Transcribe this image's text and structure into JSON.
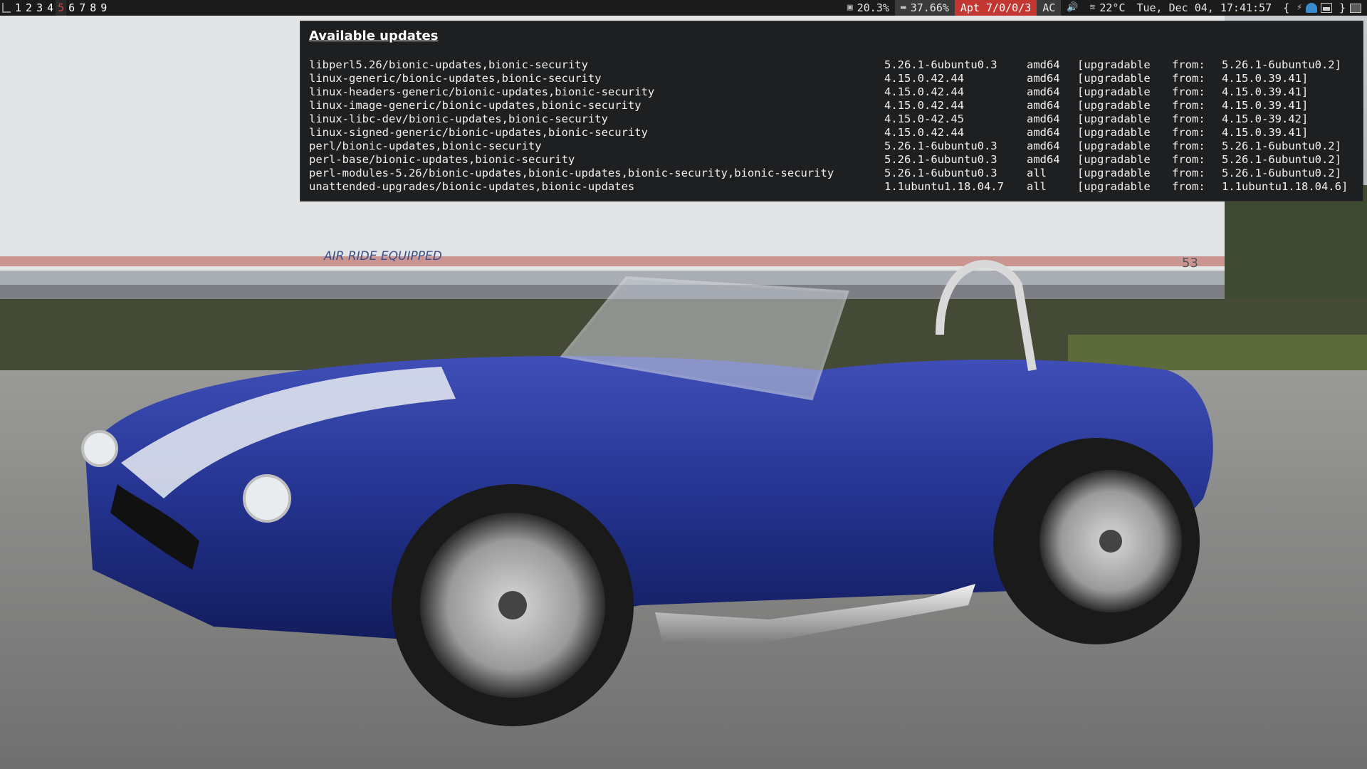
{
  "topbar": {
    "workspaces": [
      "1",
      "2",
      "3",
      "4",
      "5",
      "6",
      "7",
      "8",
      "9"
    ],
    "active_workspace_index": 4,
    "cpu": "20.3%",
    "memory": "37.66%",
    "apt": "Apt 7/0/0/3",
    "power": "AC",
    "temperature": "22°C",
    "datetime": "Tue, Dec 04, 17:41:57",
    "brace_open": "{",
    "brace_close": "}",
    "icons": [
      "layout-icon",
      "cpu-icon",
      "memory-icon",
      "volume-icon",
      "temperature-icon",
      "battery-tray-icon",
      "network-tray-icon",
      "display-tray-icon"
    ],
    "colors": {
      "apt_bg": "#c43632",
      "active_ws": "#d64040"
    }
  },
  "updates": {
    "title": "Available updates",
    "rows": [
      [
        "libperl5.26/bionic-updates,bionic-security",
        "5.26.1-6ubuntu0.3",
        "amd64",
        "[upgradable",
        "from:",
        "5.26.1-6ubuntu0.2]"
      ],
      [
        "linux-generic/bionic-updates,bionic-security",
        "4.15.0.42.44",
        "amd64",
        "[upgradable",
        "from:",
        "4.15.0.39.41]"
      ],
      [
        "linux-headers-generic/bionic-updates,bionic-security",
        "4.15.0.42.44",
        "amd64",
        "[upgradable",
        "from:",
        "4.15.0.39.41]"
      ],
      [
        "linux-image-generic/bionic-updates,bionic-security",
        "4.15.0.42.44",
        "amd64",
        "[upgradable",
        "from:",
        "4.15.0.39.41]"
      ],
      [
        "linux-libc-dev/bionic-updates,bionic-security",
        "4.15.0-42.45",
        "amd64",
        "[upgradable",
        "from:",
        "4.15.0-39.42]"
      ],
      [
        "linux-signed-generic/bionic-updates,bionic-security",
        "4.15.0.42.44",
        "amd64",
        "[upgradable",
        "from:",
        "4.15.0.39.41]"
      ],
      [
        "perl/bionic-updates,bionic-security",
        "5.26.1-6ubuntu0.3",
        "amd64",
        "[upgradable",
        "from:",
        "5.26.1-6ubuntu0.2]"
      ],
      [
        "perl-base/bionic-updates,bionic-security",
        "5.26.1-6ubuntu0.3",
        "amd64",
        "[upgradable",
        "from:",
        "5.26.1-6ubuntu0.2]"
      ],
      [
        "perl-modules-5.26/bionic-updates,bionic-updates,bionic-security,bionic-security",
        "5.26.1-6ubuntu0.3",
        "all",
        "[upgradable",
        "from:",
        "5.26.1-6ubuntu0.2]"
      ],
      [
        "unattended-upgrades/bionic-updates,bionic-updates",
        "1.1ubuntu1.18.04.7",
        "all",
        "[upgradable",
        "from:",
        "1.1ubuntu1.18.04.6]"
      ]
    ]
  },
  "wallpaper": {
    "description_icon": "car-wallpaper-image",
    "trailer_text": "AIR RIDE EQUIPPED",
    "trailer_number": "53"
  }
}
